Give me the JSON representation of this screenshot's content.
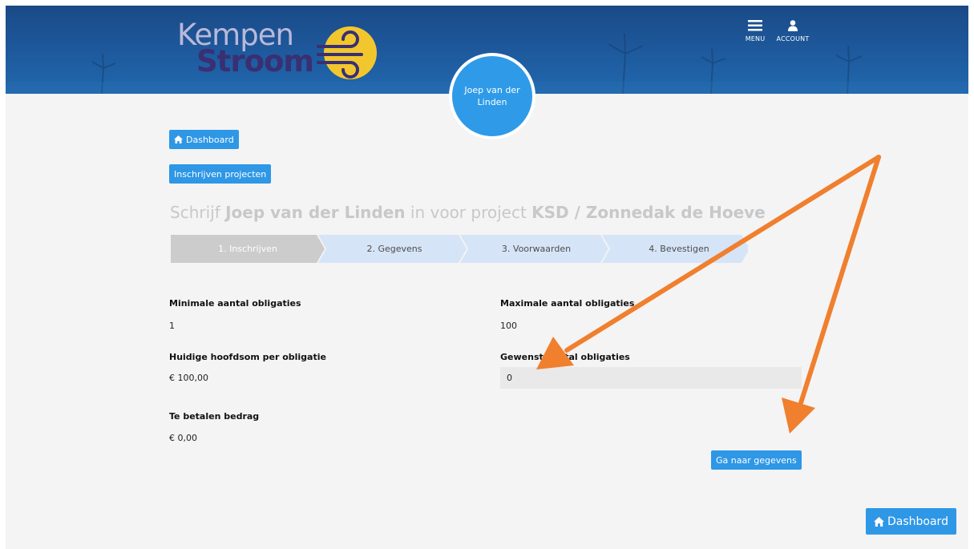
{
  "brand": {
    "logo_line1": "Kempen",
    "logo_line2": "Stroom"
  },
  "header": {
    "menu_label": "MENU",
    "account_label": "ACCOUNT",
    "menu_icon": "hamburger-icon",
    "account_icon": "user-icon"
  },
  "user": {
    "name": "Joep van der Linden"
  },
  "buttons": {
    "dashboard_top": "Dashboard",
    "subscribe_projects": "Inschrijven projecten",
    "next": "Ga naar gegevens",
    "dashboard_bottom": "Dashboard"
  },
  "heading": {
    "prefix": "Schrijf ",
    "name": "Joep van der Linden",
    "middle": " in voor project ",
    "project": "KSD / Zonnedak de Hoeve"
  },
  "steps": [
    {
      "label": "1. Inschrijven",
      "active": true
    },
    {
      "label": "2. Gegevens",
      "active": false
    },
    {
      "label": "3. Voorwaarden",
      "active": false
    },
    {
      "label": "4. Bevestigen",
      "active": false
    }
  ],
  "form": {
    "min_label": "Minimale aantal obligaties",
    "min_value": "1",
    "max_label": "Maximale aantal obligaties",
    "max_value": "100",
    "principal_label": "Huidige hoofdsom per obligatie",
    "principal_value": "€ 100,00",
    "desired_label": "Gewenst aantal obligaties",
    "desired_value": "0",
    "amount_label": "Te betalen bedrag",
    "amount_value": "€ 0,00"
  },
  "colors": {
    "header_blue": "#1e5a9e",
    "button_blue": "#2e97e6",
    "step_active": "#cccccc",
    "step_inactive": "#d6e4f7",
    "annotation_orange": "#f07f2e"
  }
}
